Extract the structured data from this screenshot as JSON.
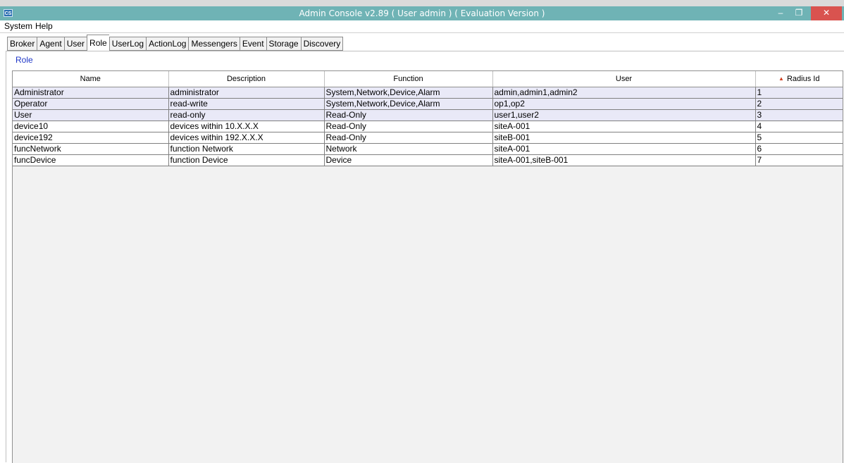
{
  "window": {
    "app_icon": "CS",
    "title": "Admin Console v2.89 ( User admin ) ( Evaluation Version )",
    "minimize_glyph": "–",
    "maximize_glyph": "❐",
    "close_glyph": "✕"
  },
  "menu": [
    "System",
    "Help"
  ],
  "tabs": [
    {
      "label": "Broker",
      "active": false
    },
    {
      "label": "Agent",
      "active": false
    },
    {
      "label": "User",
      "active": false
    },
    {
      "label": "Role",
      "active": true
    },
    {
      "label": "UserLog",
      "active": false
    },
    {
      "label": "ActionLog",
      "active": false
    },
    {
      "label": "Messengers",
      "active": false
    },
    {
      "label": "Event",
      "active": false
    },
    {
      "label": "Storage",
      "active": false
    },
    {
      "label": "Discovery",
      "active": false
    }
  ],
  "panel": {
    "label": "Role"
  },
  "table": {
    "columns": [
      {
        "label": "Name"
      },
      {
        "label": "Description"
      },
      {
        "label": "Function"
      },
      {
        "label": "User"
      },
      {
        "label": "Radius Id",
        "sort_icon": "▲"
      }
    ],
    "rows": [
      {
        "selected": true,
        "cells": [
          "Administrator",
          "administrator",
          "System,Network,Device,Alarm",
          "admin,admin1,admin2",
          "1"
        ]
      },
      {
        "selected": true,
        "cells": [
          "Operator",
          "read-write",
          "System,Network,Device,Alarm",
          "op1,op2",
          "2"
        ]
      },
      {
        "selected": true,
        "cells": [
          "User",
          "read-only",
          "Read-Only",
          "user1,user2",
          "3"
        ]
      },
      {
        "selected": false,
        "cells": [
          "device10",
          "devices within 10.X.X.X",
          "Read-Only",
          "siteA-001",
          "4"
        ]
      },
      {
        "selected": false,
        "cells": [
          "device192",
          "devices within 192.X.X.X",
          "Read-Only",
          "siteB-001",
          "5"
        ]
      },
      {
        "selected": false,
        "cells": [
          "funcNetwork",
          "function Network",
          "Network",
          "siteA-001",
          "6"
        ]
      },
      {
        "selected": false,
        "cells": [
          "funcDevice",
          "function Device",
          "Device",
          "siteA-001,siteB-001",
          "7"
        ]
      }
    ]
  },
  "colors": {
    "titlebar": "#6fb3b5",
    "close_button": "#d9534f",
    "selected_row": "#e9e9f7",
    "panel_label": "#1f37c8",
    "sort_arrow": "#d04020"
  }
}
